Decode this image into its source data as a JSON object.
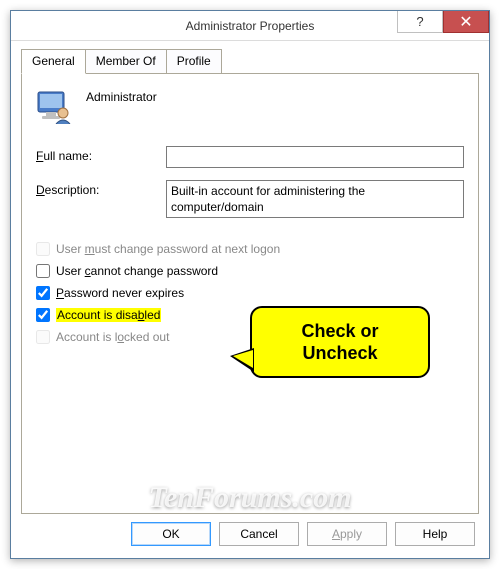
{
  "window": {
    "title": "Administrator Properties"
  },
  "tabs": {
    "general": "General",
    "member_of": "Member Of",
    "profile": "Profile"
  },
  "header": {
    "username": "Administrator"
  },
  "fields": {
    "fullname_label_pre": "",
    "fullname_label_u": "F",
    "fullname_label_post": "ull name:",
    "fullname_value": "",
    "description_label_pre": "",
    "description_label_u": "D",
    "description_label_post": "escription:",
    "description_value": "Built-in account for administering the computer/domain"
  },
  "checkboxes": {
    "must_change_pre": "User ",
    "must_change_u": "m",
    "must_change_post": "ust change password at next logon",
    "cannot_change_pre": "User ",
    "cannot_change_u": "c",
    "cannot_change_post": "annot change password",
    "never_expires_pre": "",
    "never_expires_u": "P",
    "never_expires_post": "assword never expires",
    "disabled_pre": "Account is disa",
    "disabled_u": "b",
    "disabled_post": "led",
    "locked_pre": "Account is l",
    "locked_u": "o",
    "locked_post": "cked out"
  },
  "callout": {
    "line1": "Check or",
    "line2": "Uncheck"
  },
  "buttons": {
    "ok": "OK",
    "cancel": "Cancel",
    "apply_u": "A",
    "apply_post": "pply",
    "help": "Help"
  },
  "watermark": "TenForums.com"
}
